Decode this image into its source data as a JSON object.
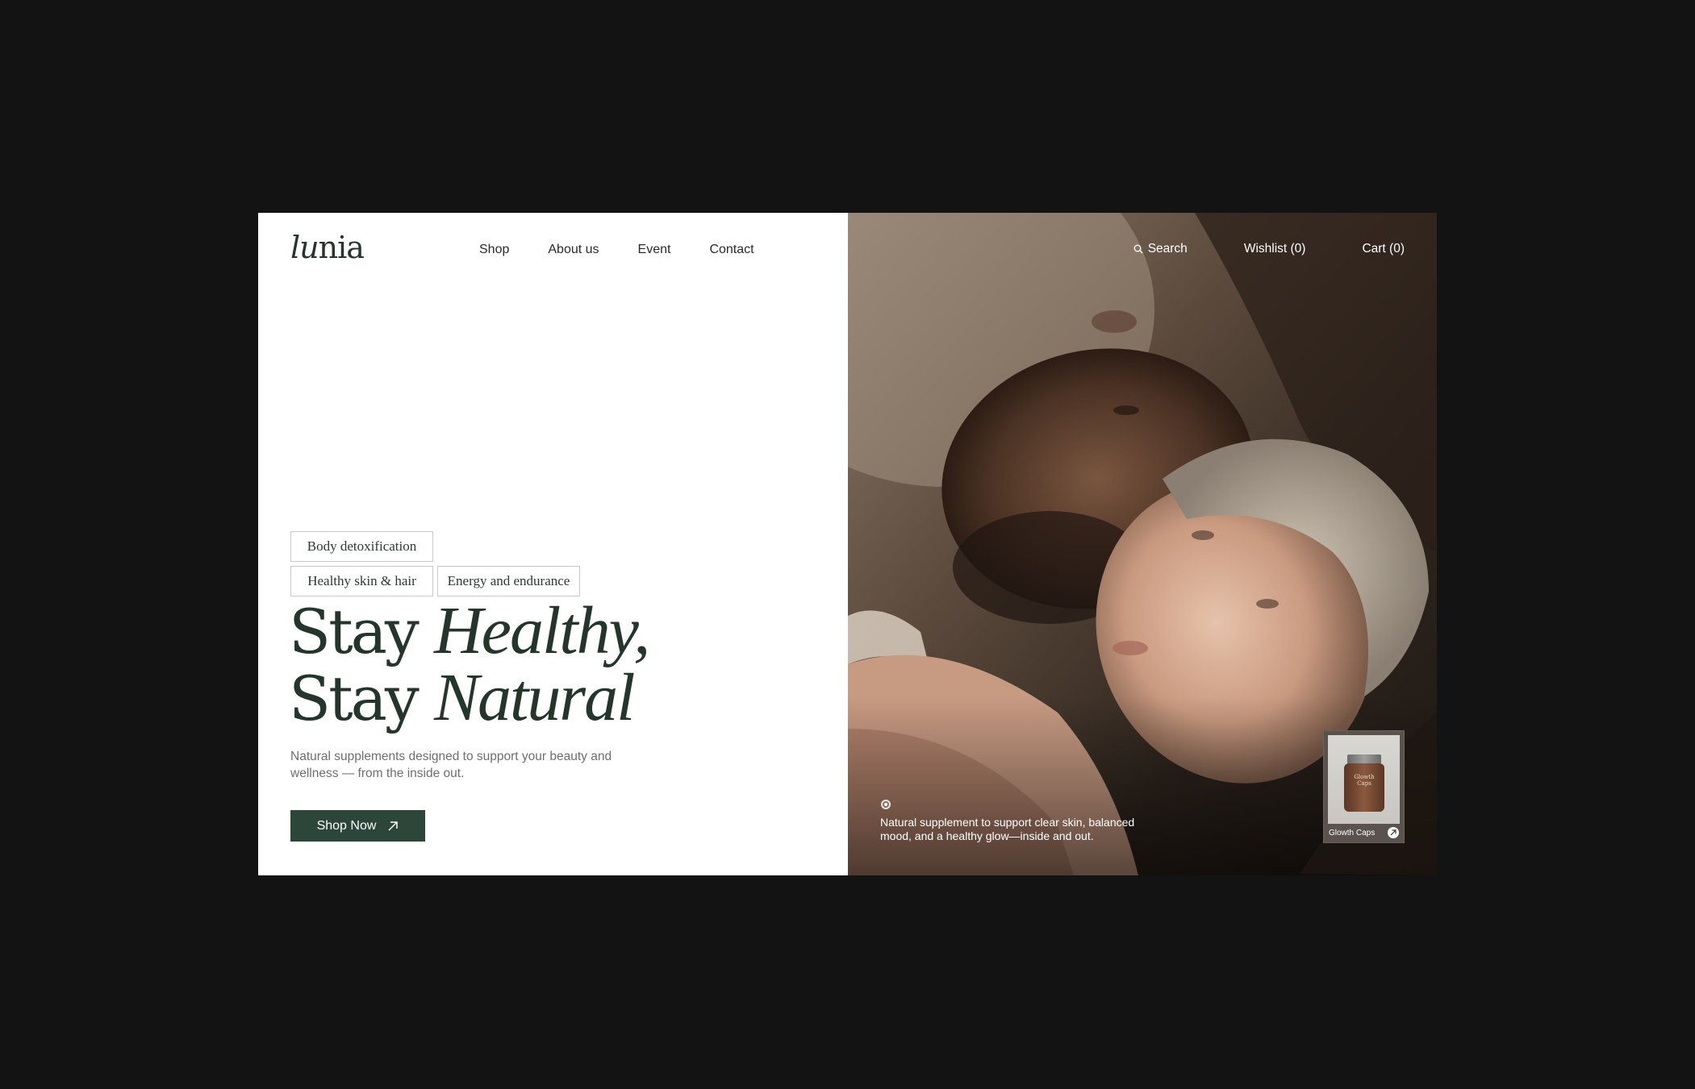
{
  "brand": {
    "logo_part1": "lu",
    "logo_part2": "nia"
  },
  "nav": {
    "items": [
      "Shop",
      "About us",
      "Event",
      "Contact"
    ]
  },
  "utility_nav": {
    "search_label": "Search",
    "wishlist_label": "Wishlist (0)",
    "cart_label": "Cart (0)"
  },
  "tags": [
    "Body detoxification",
    "Healthy skin & hair",
    "Energy and endurance"
  ],
  "hero": {
    "line1_prefix": "Stay ",
    "line1_emphasis": "Healthy,",
    "line2_prefix": "Stay ",
    "line2_emphasis": "Natural",
    "subtext": "Natural supplements designed to support your beauty and wellness — from the inside out.",
    "cta_label": "Shop Now"
  },
  "slide": {
    "caption": "Natural supplement to support clear skin, balanced mood, and a healthy glow—inside and out."
  },
  "product": {
    "name": "Glowth Caps",
    "jar_label": "Glowth Caps"
  },
  "colors": {
    "brand_green": "#2c4639",
    "heading_green": "#24362c",
    "page_background": "#131313"
  }
}
